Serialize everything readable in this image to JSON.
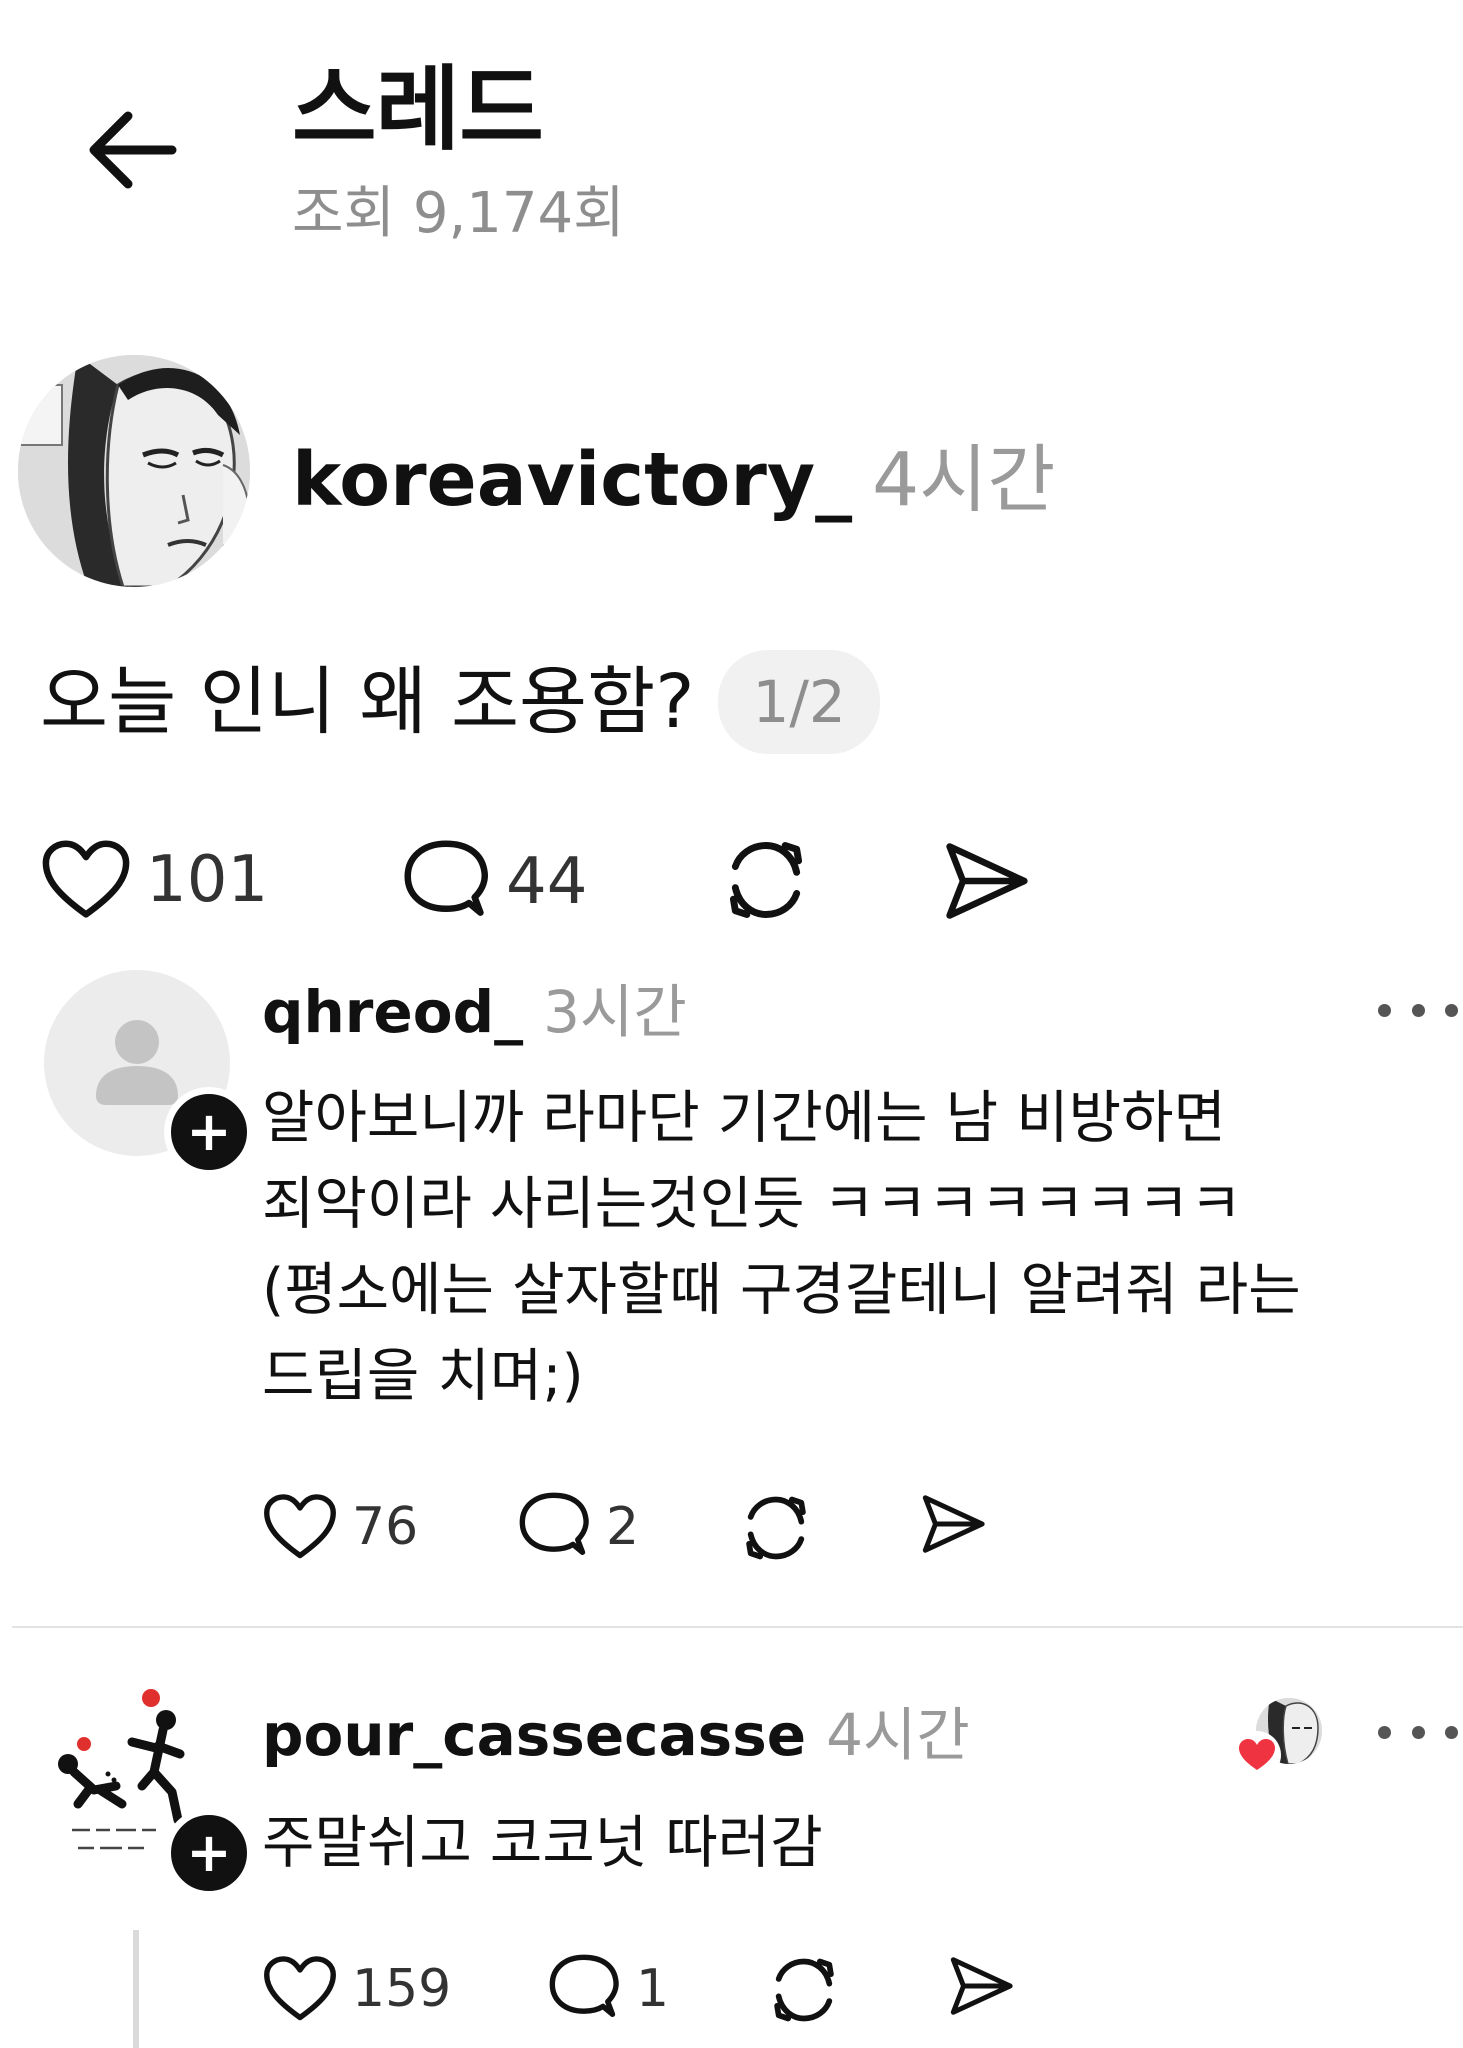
{
  "header": {
    "title": "스레드",
    "views": "조회 9,174회"
  },
  "main_post": {
    "username": "koreavictory_",
    "time": "4시간",
    "text": "오늘 인니 왜 조용함?",
    "page_indicator": "1/2",
    "likes": "101",
    "comments": "44"
  },
  "replies": [
    {
      "username": "qhreod_",
      "time": "3시간",
      "text": "알아보니까 라마단 기간에는 남 비방하면\n죄악이라 사리는것인듯 ㅋㅋㅋㅋㅋㅋㅋㅋ\n(평소에는 살자할때 구경갈테니 알려줘 라는\n드립을 치며;)",
      "likes": "76",
      "comments": "2"
    },
    {
      "username": "pour_cassecasse",
      "time": "4시간",
      "text": "주말쉬고 코코넛 따러감",
      "likes": "159",
      "comments": "1"
    }
  ],
  "icons": {
    "back": "arrow-left-icon",
    "like": "heart-icon",
    "comment": "comment-bubble-icon",
    "repost": "repost-icon",
    "share": "send-icon",
    "more": "more-dots-icon",
    "follow": "plus-icon"
  },
  "colors": {
    "text": "#111111",
    "muted": "#9a9a9a",
    "badge_bg": "#f1f1f1",
    "like_red": "#ef3340"
  }
}
